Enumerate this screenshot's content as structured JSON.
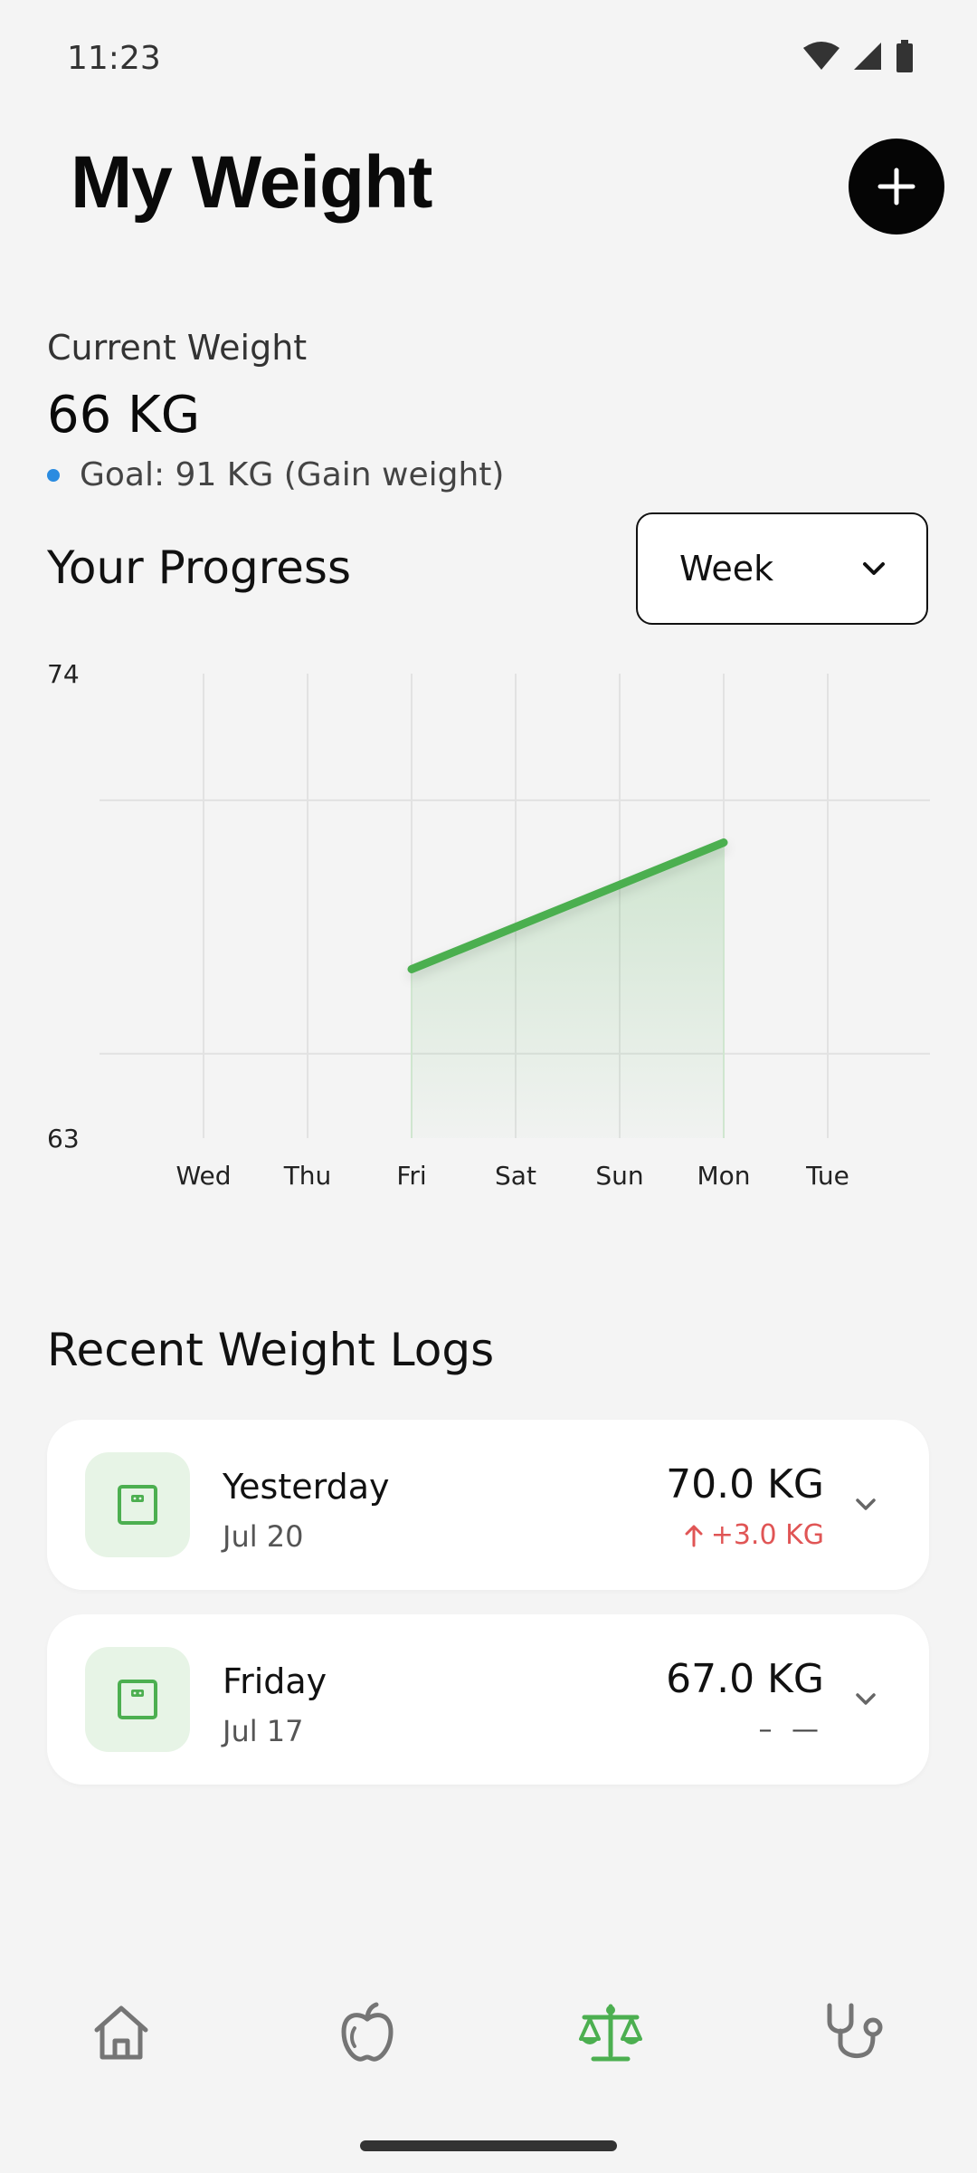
{
  "status_bar": {
    "time": "11:23",
    "icons": [
      "wifi-icon",
      "signal-icon",
      "battery-icon"
    ]
  },
  "header": {
    "title": "My Weight",
    "add_icon": "plus-icon"
  },
  "current": {
    "label": "Current Weight",
    "value": "66 KG",
    "goal": "Goal: 91 KG (Gain weight)",
    "goal_dot_color": "#2a8be0"
  },
  "progress": {
    "title": "Your Progress",
    "period": "Week"
  },
  "chart_data": {
    "type": "area",
    "categories": [
      "Wed",
      "Thu",
      "Fri",
      "Sat",
      "Sun",
      "Mon",
      "Tue"
    ],
    "series": [
      {
        "values": [
          null,
          null,
          67,
          null,
          null,
          70,
          null
        ]
      }
    ],
    "ylim": [
      63,
      74
    ],
    "y_tick_labels": [
      "74",
      "63"
    ],
    "grid": true,
    "line_color": "#4caf50"
  },
  "logs": {
    "title": "Recent Weight Logs",
    "items": [
      {
        "day": "Yesterday",
        "date": "Jul 20",
        "weight": "70.0 KG",
        "change": "+3.0 KG",
        "direction": "up",
        "icon": "scale-icon"
      },
      {
        "day": "Friday",
        "date": "Jul 17",
        "weight": "67.0 KG",
        "change": "– —",
        "direction": "none",
        "icon": "scale-icon"
      }
    ]
  },
  "nav": {
    "items": [
      {
        "icon": "home-icon",
        "active": false
      },
      {
        "icon": "apple-icon",
        "active": false
      },
      {
        "icon": "balance-scale-icon",
        "active": true
      },
      {
        "icon": "stethoscope-icon",
        "active": false
      }
    ],
    "active_color": "#4caf50",
    "inactive_color": "#757575"
  }
}
